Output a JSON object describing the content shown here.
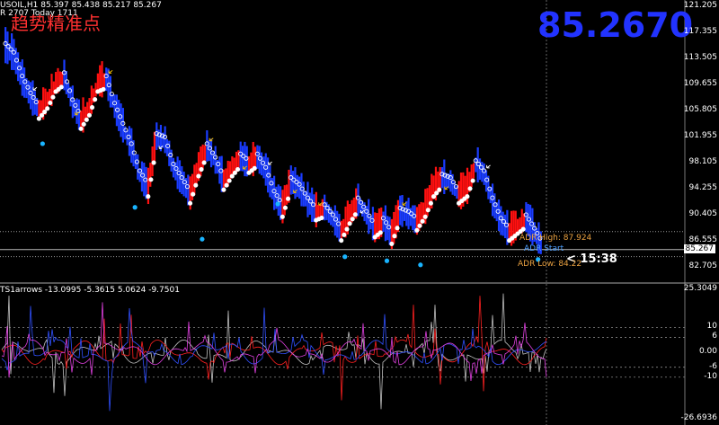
{
  "header": {
    "symbol_line": "USOIL,H1  85.397 85.438 85.217 85.267",
    "bar_line": "R 2707  Today 1711",
    "watermark": "趋势精准点",
    "big_price": "85.2670"
  },
  "price_axis": {
    "ticks": [
      "121.205",
      "117.355",
      "113.505",
      "109.655",
      "105.805",
      "101.955",
      "98.105",
      "94.255",
      "90.405",
      "86.555",
      "82.705"
    ],
    "current_price_label": "85.267"
  },
  "adr": {
    "high_label": "ADR High: 87.924",
    "start_label": "ADR Start",
    "low_label": "ADR Low: 84.22",
    "high_color": "#e8a040",
    "start_color": "#4fa0ff",
    "low_color": "#e8a040"
  },
  "countdown": "< 15:38",
  "indicator": {
    "title": "TS1arrows -13.0995 -5.3615 5.0624 -9.7501",
    "ticks": [
      "25.3049",
      "10",
      "6",
      "0.00",
      "-6",
      "-10",
      "-26.6936"
    ]
  },
  "colors": {
    "up_candle": "#ff1010",
    "down_candle": "#1a3cff",
    "trail_dots": "#ffffff",
    "signal_dots": "#19b4ff",
    "big_price": "#2233ff",
    "watermark": "#ff3030"
  },
  "chart_data": {
    "type": "line",
    "ylim": [
      81.0,
      123.0
    ],
    "x": [
      0,
      1,
      2,
      3,
      4,
      5,
      6,
      7,
      8,
      9,
      10,
      11,
      12,
      13,
      14,
      15,
      16,
      17,
      18,
      19,
      20,
      21,
      22,
      23,
      24,
      25,
      26,
      27,
      28,
      29,
      30,
      31,
      32,
      33,
      34,
      35,
      36,
      37,
      38,
      39,
      40,
      41,
      42,
      43,
      44,
      45,
      46,
      47,
      48,
      49,
      50,
      51,
      52,
      53,
      54,
      55,
      56,
      57,
      58,
      59,
      60,
      61,
      62,
      63,
      64
    ],
    "series": [
      {
        "values": [
          114.8,
          113.5,
          110.0,
          107.5,
          105.5,
          107.0,
          109.5,
          110.5,
          106.5,
          104.0,
          106.0,
          109.5,
          110.0,
          106.0,
          103.0,
          100.0,
          96.0,
          94.0,
          101.5,
          101.0,
          97.0,
          95.0,
          93.0,
          97.0,
          100.0,
          98.0,
          95.0,
          97.0,
          98.5,
          97.5,
          98.5,
          96.5,
          93.0,
          91.0,
          95.0,
          94.0,
          92.0,
          90.5,
          91.0,
          89.5,
          87.5,
          90.0,
          92.0,
          90.0,
          88.0,
          89.0,
          87.0,
          90.5,
          90.0,
          89.0,
          91.0,
          94.0,
          95.5,
          95.0,
          93.0,
          94.0,
          97.5,
          96.0,
          92.0,
          89.0,
          87.5,
          88.5,
          89.5,
          87.5,
          85.3
        ]
      }
    ]
  }
}
